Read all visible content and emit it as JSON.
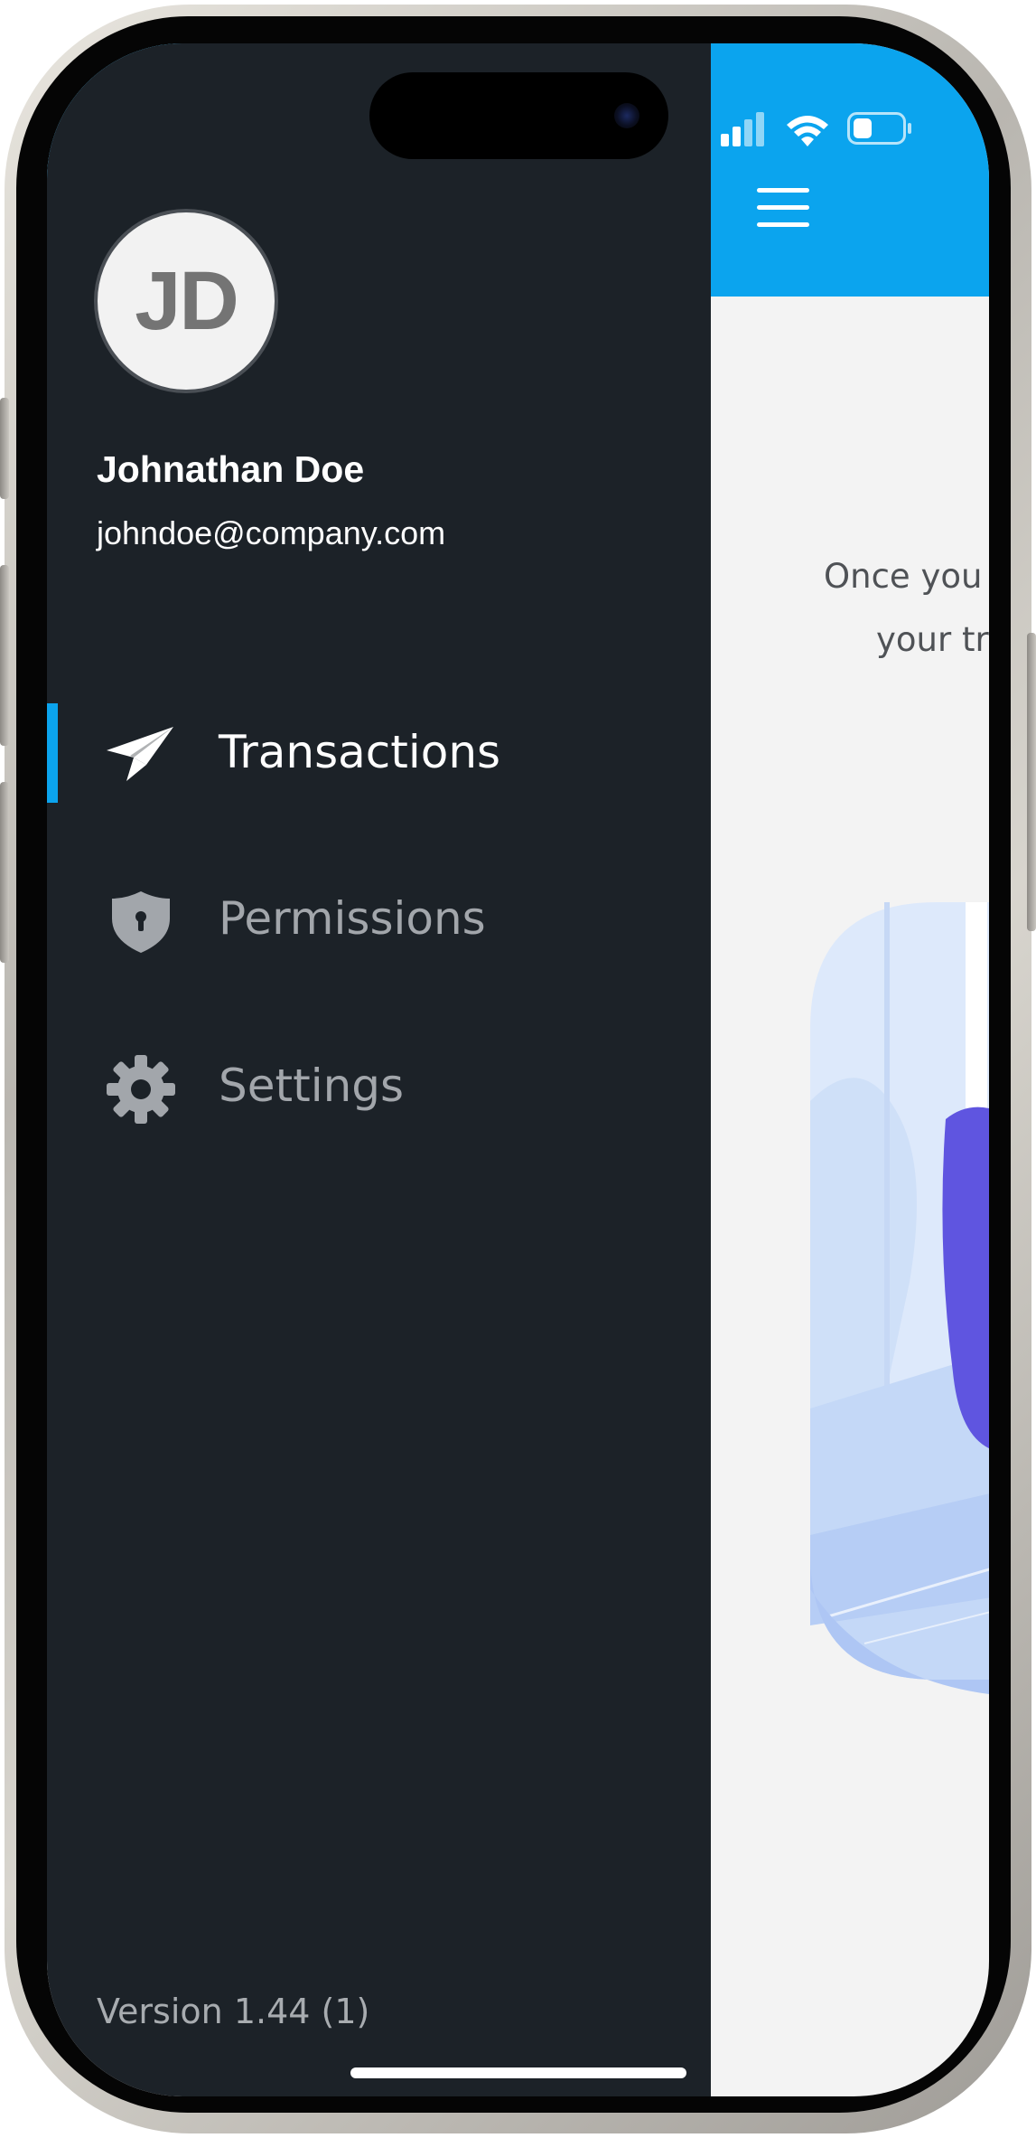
{
  "status_bar": {
    "signal_icon": "cellular-signal-icon",
    "wifi_icon": "wifi-icon",
    "battery_icon": "battery-icon"
  },
  "drawer": {
    "avatar_initials": "JD",
    "user_name": "Johnathan Doe",
    "user_email": "johndoe@company.com",
    "items": [
      {
        "label": "Transactions",
        "icon": "paper-plane-icon",
        "active": true
      },
      {
        "label": "Permissions",
        "icon": "shield-lock-icon",
        "active": false
      },
      {
        "label": "Settings",
        "icon": "gear-icon",
        "active": false
      }
    ],
    "version": "Version 1.44 (1)"
  },
  "main": {
    "menu_icon": "hamburger-menu-icon",
    "empty_state_line1": "Once you",
    "empty_state_line2": "your tr"
  },
  "colors": {
    "header_accent": "#0ba4ee",
    "drawer_background": "#1c2228",
    "active_indicator": "#0ba4ee",
    "content_background": "#f3f3f3"
  }
}
